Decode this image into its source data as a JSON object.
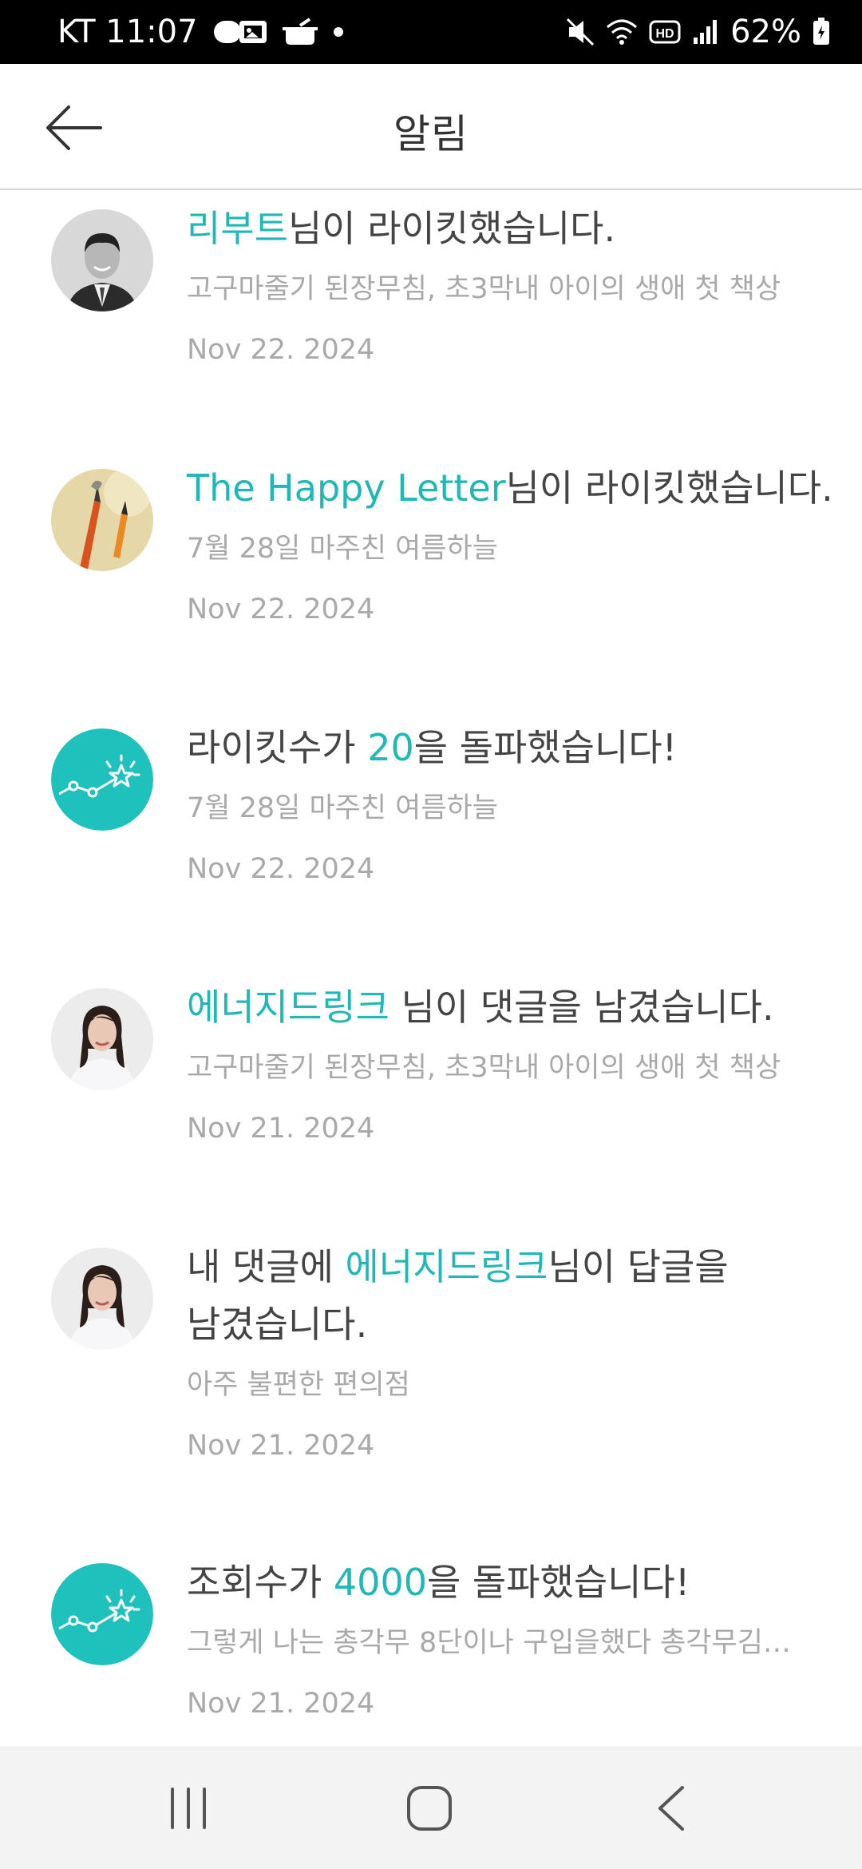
{
  "status_bar": {
    "carrier_time": "KT 11:07",
    "battery": "62%",
    "icons": [
      "pill-icon",
      "pot-icon",
      "dot-icon",
      "mute-icon",
      "wifi-icon",
      "hd-icon",
      "signal-icon",
      "battery-icon"
    ]
  },
  "header": {
    "title": "알림",
    "back_icon": "arrow-left-icon"
  },
  "notifications": [
    {
      "avatar": "person-photo",
      "highlight": "리부트",
      "message_rest": "님이 라이킷했습니다.",
      "subtitle": "고구마줄기 된장무침, 초3막내 아이의 생애 첫 책상",
      "date": "Nov 22. 2024"
    },
    {
      "avatar": "pencil-photo",
      "highlight": "The Happy Letter",
      "message_rest": "님이 라이킷했습니다.",
      "subtitle": "7월 28일 마주친 여름하늘",
      "date": "Nov 22. 2024"
    },
    {
      "avatar": "milestone-icon",
      "message_pre": "라이킷수가 ",
      "highlight": "20",
      "message_rest": "을 돌파했습니다!",
      "subtitle": "7월 28일 마주친 여름하늘",
      "date": "Nov 22. 2024"
    },
    {
      "avatar": "woman-photo",
      "highlight": "에너지드링크",
      "message_rest": " 님이 댓글을 남겼습니다.",
      "subtitle": "고구마줄기 된장무침, 초3막내 아이의 생애 첫 책상",
      "date": "Nov 21. 2024"
    },
    {
      "avatar": "woman-photo",
      "message_pre": "내 댓글에 ",
      "highlight": "에너지드링크",
      "message_rest": "님이 답글을 남겼습니다.",
      "subtitle": "아주 불편한 편의점",
      "date": "Nov 21. 2024"
    },
    {
      "avatar": "milestone-icon",
      "message_pre": "조회수가 ",
      "highlight": "4000",
      "message_rest": "을 돌파했습니다!",
      "subtitle": "그렇게 나는 총각무 8단이나 구입을했다 총각무김…",
      "date": "Nov 21. 2024"
    }
  ],
  "nav_bar": {
    "recents_icon": "recents-icon",
    "home_icon": "home-icon",
    "back_icon": "back-chevron-icon"
  },
  "colors": {
    "accent": "#1fb8b6",
    "text": "#444444",
    "muted": "#a9a9a9",
    "status_bar_bg": "#000000",
    "nav_bar_bg": "#f3f3f3"
  }
}
